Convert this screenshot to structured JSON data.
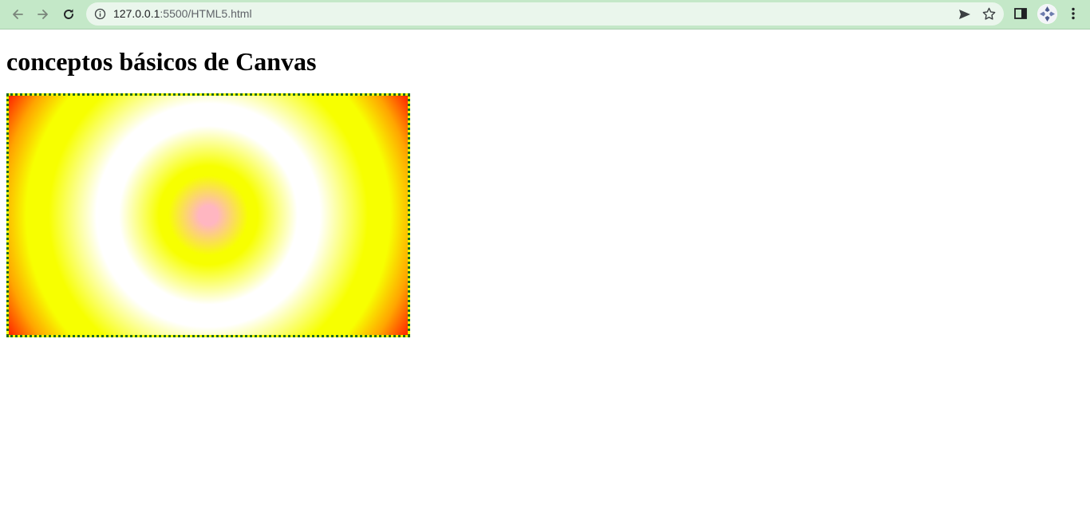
{
  "browser": {
    "url_host": "127.0.0.1",
    "url_rest": ":5500/HTML5.html",
    "icons": [
      "back-icon",
      "forward-icon",
      "reload-icon",
      "info-icon",
      "send-icon",
      "star-icon",
      "side-panel-icon",
      "avatar",
      "menu-icon"
    ],
    "colors": {
      "toolbar": "#c4e8c8",
      "omnibox": "#eaf6ec"
    }
  },
  "page": {
    "title": "conceptos básicos de Canvas",
    "canvas": {
      "border_color": "#1d6b1d",
      "border_style": "dotted",
      "gradient_type": "radial",
      "gradient_colors": [
        "#ffb6c1",
        "#f7ff00",
        "#ffffff",
        "#f7ff00",
        "#ffa500",
        "#ff0000"
      ]
    }
  }
}
